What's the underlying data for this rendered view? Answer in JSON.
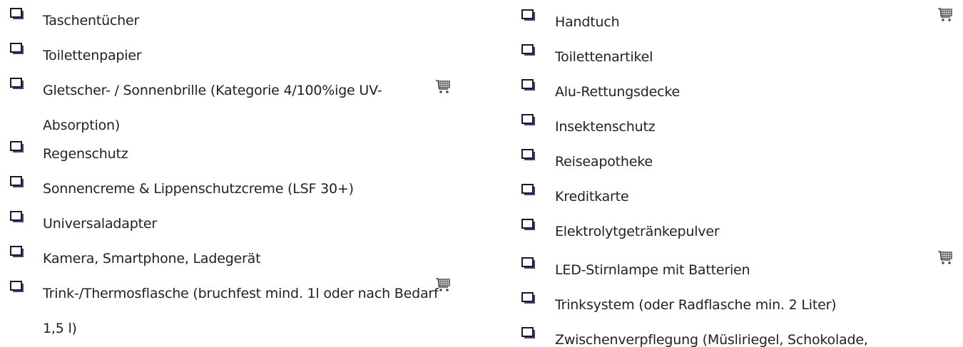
{
  "left_column": [
    {
      "label": "Taschentücher",
      "cart": false
    },
    {
      "label": "Toilettenpapier",
      "cart": false
    },
    {
      "label": "Gletscher- / Sonnenbrille (Kategorie 4/100%ige UV-Absorption)",
      "cart": true
    },
    {
      "label": "Regenschutz",
      "cart": false
    },
    {
      "label": "Sonnencreme & Lippenschutzcreme (LSF 30+)",
      "cart": false
    },
    {
      "label": "Universaladapter",
      "cart": false
    },
    {
      "label": "Kamera, Smartphone, Ladegerät",
      "cart": false
    },
    {
      "label": "Trink-/Thermosflasche (bruchfest mind. 1l oder nach Bedarf 1,5 l)",
      "cart": true
    }
  ],
  "right_column": [
    {
      "label": "Handtuch",
      "cart": true
    },
    {
      "label": "Toilettenartikel",
      "cart": false
    },
    {
      "label": "Alu-Rettungsdecke",
      "cart": false
    },
    {
      "label": "Insektenschutz",
      "cart": false
    },
    {
      "label": "Reiseapotheke",
      "cart": false
    },
    {
      "label": "Kreditkarte",
      "cart": false
    },
    {
      "label": "Elektrolytgetränkepulver",
      "cart": false
    },
    {
      "label": "LED-Stirnlampe mit Batterien",
      "cart": true
    },
    {
      "label": "Trinksystem (oder Radflasche min. 2 Liter)",
      "cart": false
    },
    {
      "label": "Zwischenverpflegung (Müsliriegel, Schokolade,",
      "cart": false
    }
  ],
  "icons": {
    "checkbox": "checkbox-icon",
    "cart": "shopping-cart-icon"
  },
  "colors": {
    "checkbox_border": "#1a1a2e",
    "checkbox_shadow": "#3b3f8c",
    "cart": "#4a4a4a",
    "text": "#222222"
  }
}
